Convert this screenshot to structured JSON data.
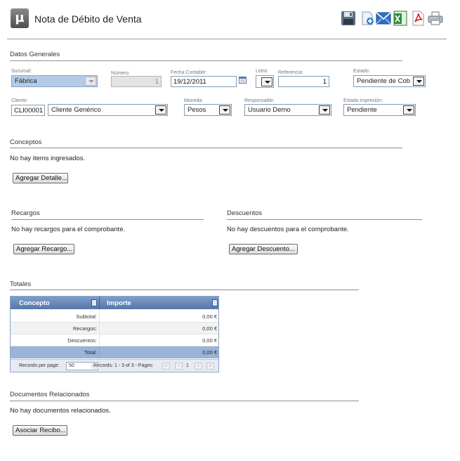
{
  "app": {
    "icon_glyph": "µ",
    "title": "Nota de Débito de Venta"
  },
  "toolbar": {
    "icons": [
      "save-icon",
      "add-icon",
      "email-icon",
      "excel-icon",
      "pdf-icon",
      "print-icon"
    ]
  },
  "general": {
    "section_title": "Datos Generales",
    "sucursal": {
      "label": "Sucursal:",
      "value": "Fábrica"
    },
    "numero": {
      "label": "Número:",
      "value": "1"
    },
    "fecha": {
      "label": "Fecha Contable:",
      "value": "19/12/2011"
    },
    "letra": {
      "label": "Letra:",
      "value": ""
    },
    "referencia": {
      "label": "Referencia:",
      "value": "1"
    },
    "estado": {
      "label": "Estado:",
      "value": "Pendiente de Cob"
    },
    "cliente": {
      "label": "Cliente:",
      "code": "CLI00001",
      "name": "Cliente Genérico"
    },
    "moneda": {
      "label": "Moneda:",
      "value": "Pesos"
    },
    "responsable": {
      "label": "Responsable:",
      "value": "Usuario Demo"
    },
    "estado_impresion": {
      "label": "Estado impresión:",
      "value": "Pendiente"
    }
  },
  "conceptos": {
    "section_title": "Conceptos",
    "empty_message": "No hay items ingresados.",
    "button": "Agregar Detalle..."
  },
  "recargos": {
    "section_title": "Recargos",
    "empty_message": "No hay recargos para el comprobante.",
    "button": "Agregar Recargo..."
  },
  "descuentos": {
    "section_title": "Descuentos",
    "empty_message": "No hay descuentos para el comprobante.",
    "button": "Agregar Descuento..."
  },
  "totales": {
    "section_title": "Totales",
    "columns": [
      "Concepto",
      "Importe"
    ],
    "rows": [
      {
        "label": "Subtotal:",
        "value": "0,00 €"
      },
      {
        "label": "Recargos:",
        "value": "0,00 €"
      },
      {
        "label": "Descuentos:",
        "value": "0,00 €"
      },
      {
        "label": "Total:",
        "value": "0,00 €"
      }
    ],
    "pager": {
      "records_label": "Records per page:",
      "records_value": "50",
      "info": "Records: 1 - 3 of 3 - Pages:",
      "page": "1",
      "first": "«",
      "prev": "‹",
      "next": "›",
      "last": "»"
    }
  },
  "documentos": {
    "section_title": "Documentos Relacionados",
    "empty_message": "No hay documentos relacionados.",
    "button": "Asociar Recibo..."
  }
}
